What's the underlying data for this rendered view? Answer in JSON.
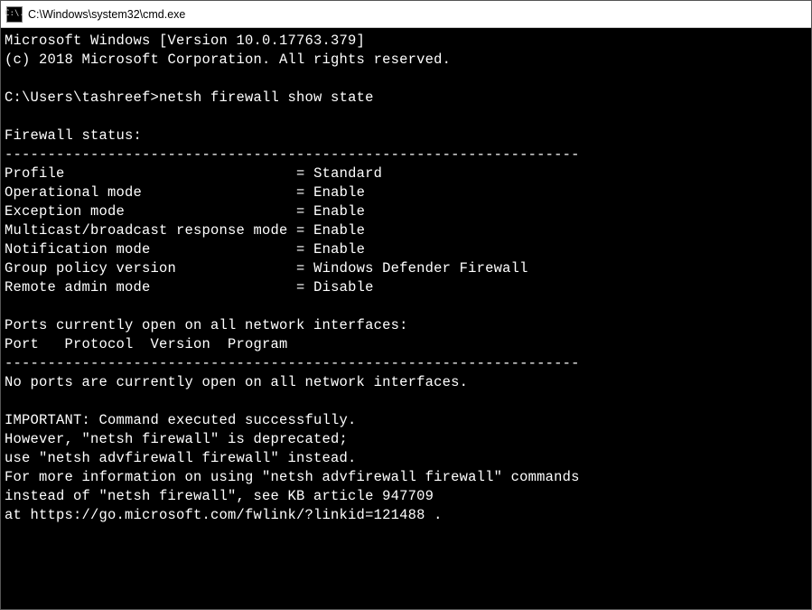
{
  "titlebar": {
    "icon_label": "C:\\.",
    "title": "C:\\Windows\\system32\\cmd.exe"
  },
  "terminal": {
    "version_line": "Microsoft Windows [Version 10.0.17763.379]",
    "copyright_line": "(c) 2018 Microsoft Corporation. All rights reserved.",
    "prompt": "C:\\Users\\tashreef>",
    "command": "netsh firewall show state",
    "status_header": "Firewall status:",
    "divider": "-------------------------------------------------------------------",
    "rows": [
      {
        "label": "Profile                           = ",
        "value": "Standard"
      },
      {
        "label": "Operational mode                  = ",
        "value": "Enable"
      },
      {
        "label": "Exception mode                    = ",
        "value": "Enable"
      },
      {
        "label": "Multicast/broadcast response mode = ",
        "value": "Enable"
      },
      {
        "label": "Notification mode                 = ",
        "value": "Enable"
      },
      {
        "label": "Group policy version              = ",
        "value": "Windows Defender Firewall"
      },
      {
        "label": "Remote admin mode                 = ",
        "value": "Disable"
      }
    ],
    "ports_header": "Ports currently open on all network interfaces:",
    "ports_columns": "Port   Protocol  Version  Program",
    "no_ports": "No ports are currently open on all network interfaces.",
    "important1": "IMPORTANT: Command executed successfully.",
    "important2": "However, \"netsh firewall\" is deprecated;",
    "important3": "use \"netsh advfirewall firewall\" instead.",
    "important4": "For more information on using \"netsh advfirewall firewall\" commands",
    "important5": "instead of \"netsh firewall\", see KB article 947709",
    "important6": "at https://go.microsoft.com/fwlink/?linkid=121488 ."
  }
}
